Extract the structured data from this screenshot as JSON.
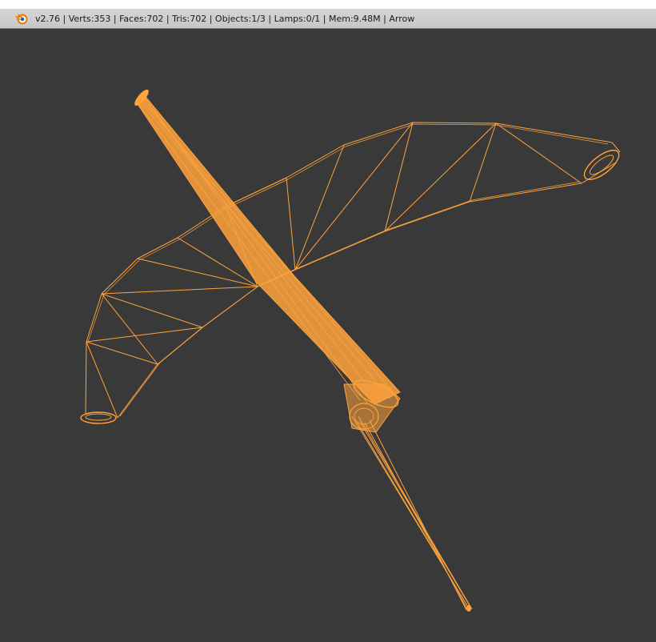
{
  "app": {
    "name": "Blender",
    "logo_icon": "blender-logo-icon"
  },
  "info_bar": {
    "text": "v2.76 | Verts:353 | Faces:702 | Tris:702 | Objects:1/3 | Lamps:0/1 | Mem:9.48M | Arrow"
  },
  "viewport": {
    "mode": "wireframe",
    "background_color": "#393939",
    "wire_color": "#ffa33d",
    "object_name": "Arrow"
  }
}
